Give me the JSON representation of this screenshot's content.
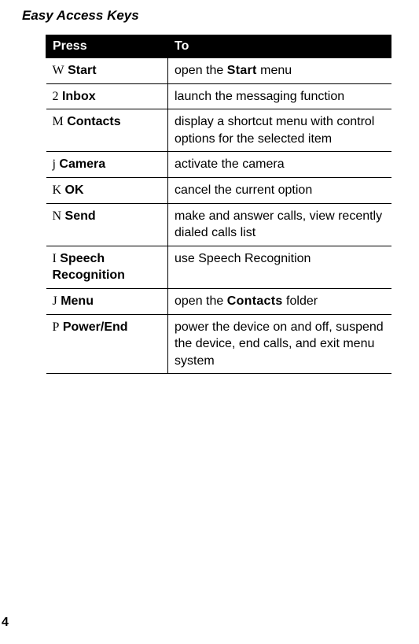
{
  "section_title": "Easy Access Keys",
  "table": {
    "header": {
      "press": "Press",
      "to": "To"
    },
    "rows": [
      {
        "prefix": "W",
        "key": "Start",
        "to_pre": "open the ",
        "to_label": "Start",
        "to_post": " menu"
      },
      {
        "prefix": "2",
        "key": "Inbox",
        "to_pre": "launch the messaging function",
        "to_label": "",
        "to_post": ""
      },
      {
        "prefix": "M",
        "key": "Contacts",
        "to_pre": "display a shortcut menu with control options for the selected item",
        "to_label": "",
        "to_post": ""
      },
      {
        "prefix": "j",
        "key": "Camera",
        "to_pre": "activate the camera",
        "to_label": "",
        "to_post": ""
      },
      {
        "prefix": "K",
        "key": "OK",
        "to_pre": "cancel the current option",
        "to_label": "",
        "to_post": ""
      },
      {
        "prefix": "N",
        "key": "Send",
        "to_pre": "make and answer calls, view recently dialed calls list",
        "to_label": "",
        "to_post": ""
      },
      {
        "prefix": "I",
        "key": "Speech Recognition",
        "to_pre": "use Speech Recognition",
        "to_label": "",
        "to_post": ""
      },
      {
        "prefix": "J",
        "key": "Menu",
        "to_pre": "open the ",
        "to_label": "Contacts",
        "to_post": " folder"
      },
      {
        "prefix": "P",
        "key": "Power/End",
        "to_pre": "power the device on and off, suspend the device, end calls, and exit menu system",
        "to_label": "",
        "to_post": ""
      }
    ]
  },
  "page_number": "4"
}
